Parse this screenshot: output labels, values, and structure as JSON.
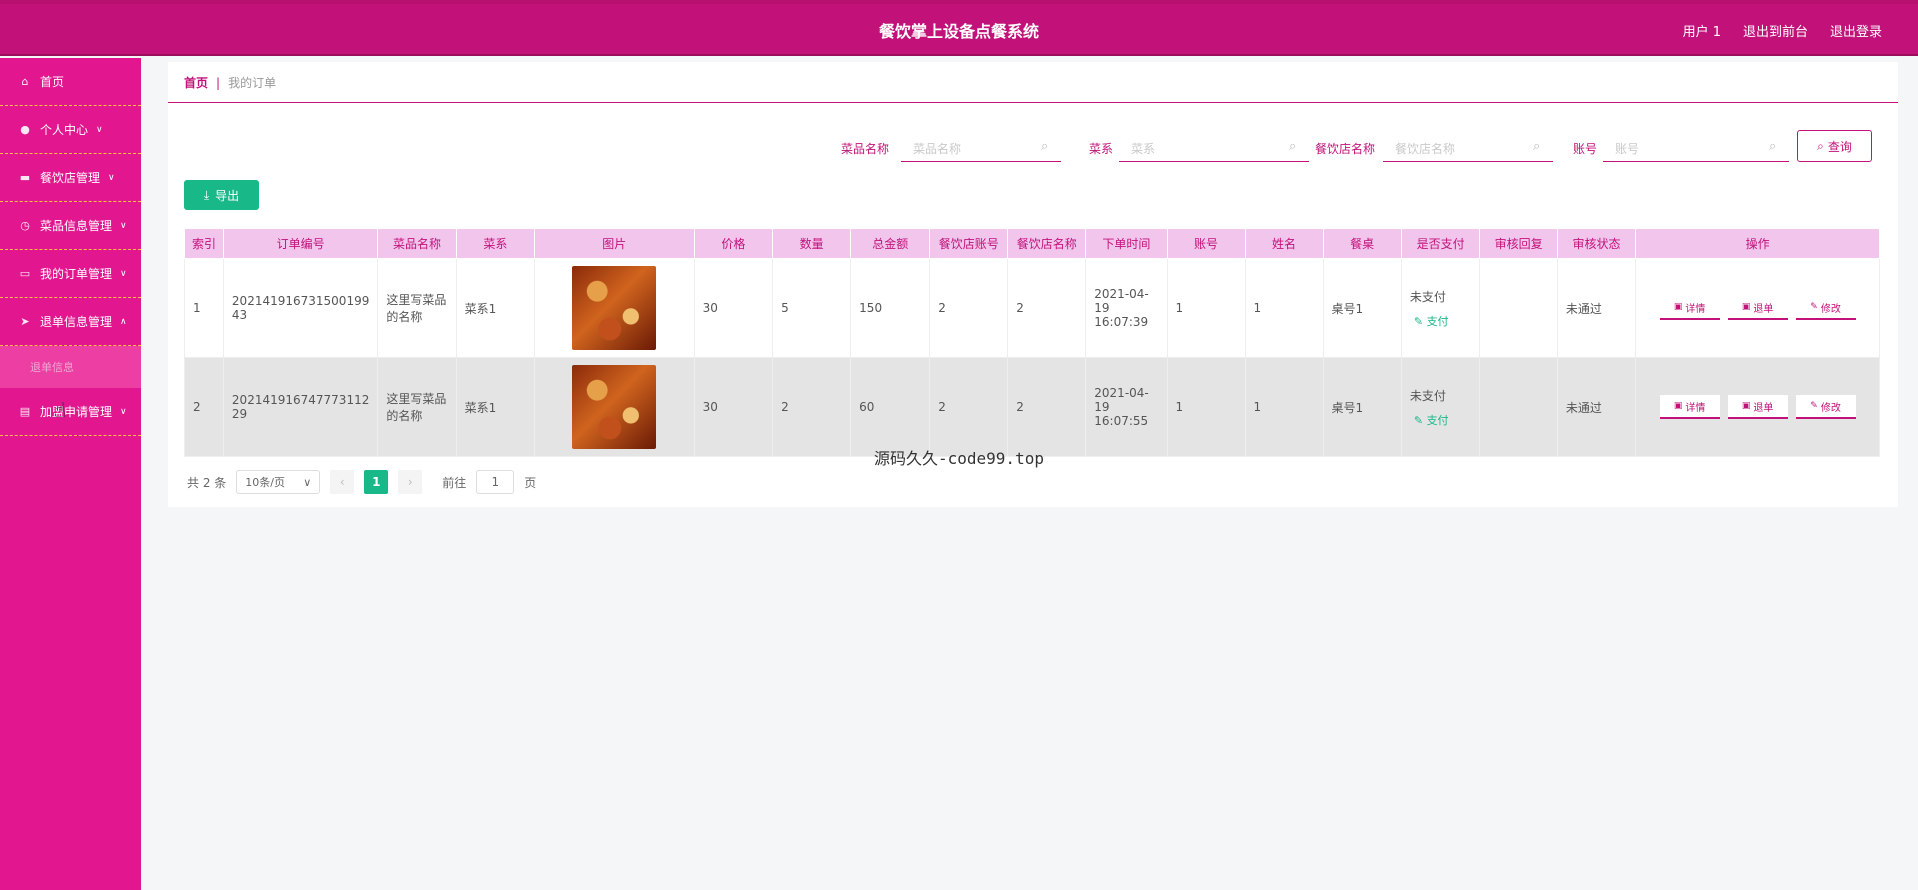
{
  "header": {
    "title": "餐饮掌上设备点餐系统",
    "user_label": "用户 1",
    "back_label": "退出到前台",
    "logout_label": "退出登录"
  },
  "sidebar": {
    "items": [
      {
        "label": "首页",
        "icon": "home-icon"
      },
      {
        "label": "个人中心",
        "icon": "user-icon"
      },
      {
        "label": "餐饮店管理",
        "icon": "store-icon"
      },
      {
        "label": "菜品信息管理",
        "icon": "dish-icon"
      },
      {
        "label": "我的订单管理",
        "icon": "order-icon"
      },
      {
        "label": "退单信息管理",
        "icon": "send-icon"
      },
      {
        "label": "加盟申请管理",
        "icon": "apply-icon"
      }
    ],
    "sub_item": "退单信息"
  },
  "breadcrumb": {
    "home": "首页",
    "current": "我的订单"
  },
  "search": {
    "dish_label": "菜品名称",
    "dish_placeholder": "菜品名称",
    "cuisine_label": "菜系",
    "cuisine_placeholder": "菜系",
    "shop_label": "餐饮店名称",
    "shop_placeholder": "餐饮店名称",
    "account_label": "账号",
    "account_placeholder": "账号",
    "query_label": "查询"
  },
  "toolbar": {
    "export_label": "导出"
  },
  "table": {
    "headers": [
      "索引",
      "订单编号",
      "菜品名称",
      "菜系",
      "图片",
      "价格",
      "数量",
      "总金额",
      "餐饮店账号",
      "餐饮店名称",
      "下单时间",
      "账号",
      "姓名",
      "餐桌",
      "是否支付",
      "审核回复",
      "审核状态",
      "操作"
    ],
    "rows": [
      {
        "index": "1",
        "order_no": "202141916731500199 43",
        "dish": "这里写菜品的名称",
        "cuisine": "菜系1",
        "price": "30",
        "qty": "5",
        "total": "150",
        "shop_account": "2",
        "shop_name": "2",
        "time": "2021-04-19 16:07:39",
        "account": "1",
        "name": "1",
        "table_no": "桌号1",
        "paid": "未支付",
        "pay_link": "支付",
        "reply": "",
        "status": "未通过"
      },
      {
        "index": "2",
        "order_no": "202141916747773112 29",
        "dish": "这里写菜品的名称",
        "cuisine": "菜系1",
        "price": "30",
        "qty": "2",
        "total": "60",
        "shop_account": "2",
        "shop_name": "2",
        "time": "2021-04-19 16:07:55",
        "account": "1",
        "name": "1",
        "table_no": "桌号1",
        "paid": "未支付",
        "pay_link": "支付",
        "reply": "",
        "status": "未通过"
      }
    ],
    "ops": {
      "detail": "详情",
      "refund": "退单",
      "edit": "修改"
    }
  },
  "pagination": {
    "total": "共 2 条",
    "page_size": "10条/页",
    "current": "1",
    "goto_prefix": "前往",
    "goto_value": "1",
    "goto_suffix": "页"
  },
  "footer_tag": "源码久久-code99.top",
  "colors": {
    "primary": "#c2127a",
    "sidebar": "#e2178f",
    "accent": "#18b889"
  }
}
